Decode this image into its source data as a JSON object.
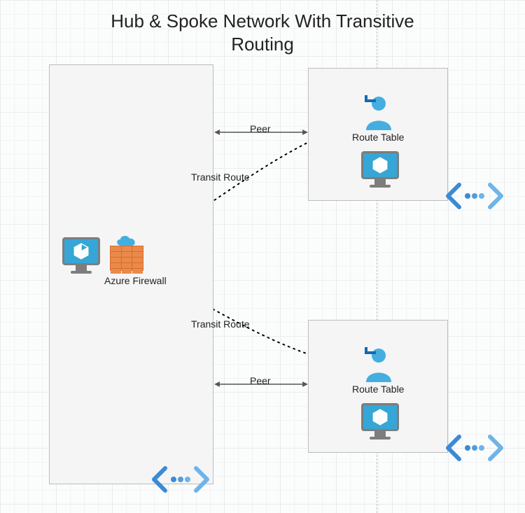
{
  "title_line1": "Hub & Spoke Network With Transitive",
  "title_line2": "Routing",
  "hub": {
    "firewall_label": "Azure Firewall"
  },
  "spoke_a": {
    "route_table_label": "Route Table"
  },
  "spoke_b": {
    "route_table_label": "Route Table"
  },
  "edges": {
    "peer_top": "Peer",
    "peer_bottom": "Peer",
    "transit_top": "Transit Route",
    "transit_bottom": "Transit Route"
  }
}
